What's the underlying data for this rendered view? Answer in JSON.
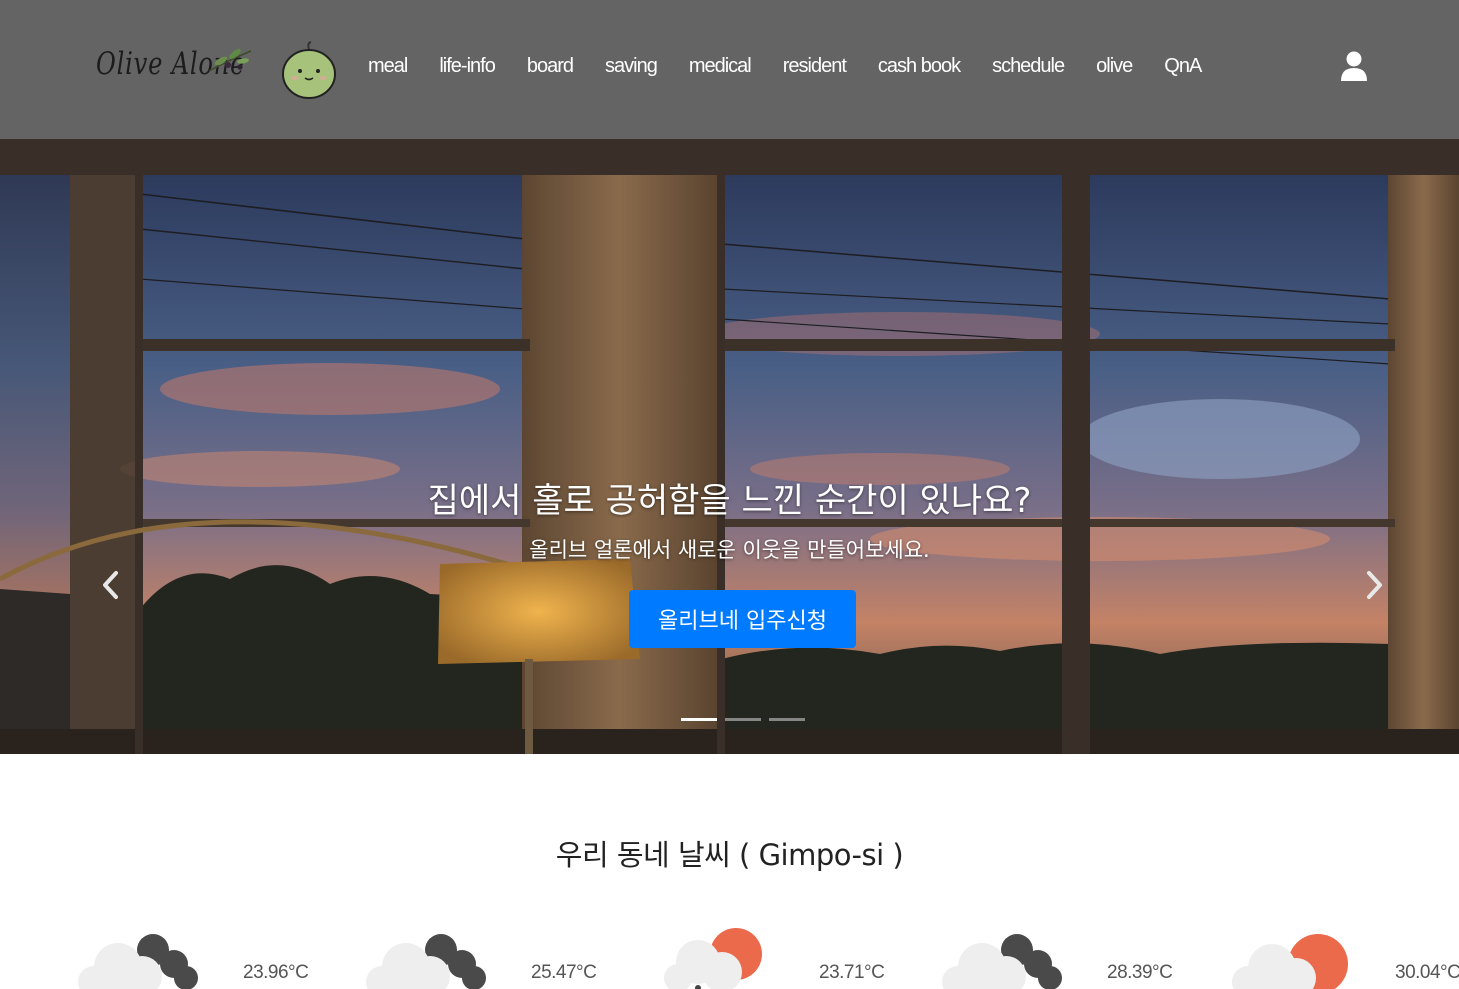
{
  "brand": {
    "logo_text": "Olive Alone"
  },
  "nav": {
    "items": [
      {
        "label": "meal"
      },
      {
        "label": "life-info"
      },
      {
        "label": "board"
      },
      {
        "label": "saving"
      },
      {
        "label": "medical"
      },
      {
        "label": "resident"
      },
      {
        "label": "cash book"
      },
      {
        "label": "schedule"
      },
      {
        "label": "olive"
      },
      {
        "label": "QnA"
      }
    ],
    "user_icon": "user-icon"
  },
  "hero": {
    "title": "집에서 홀로 공허함을 느낀 순간이 있나요?",
    "subtitle": "올리브 얼론에서 새로운 이웃을 만들어보세요.",
    "button_label": "올리브네 입주신청",
    "slide_count": 3,
    "active_slide": 1,
    "prev_icon": "chevron-left-icon",
    "next_icon": "chevron-right-icon"
  },
  "weather": {
    "title": "우리 동네 날씨 ( Gimpo-si )",
    "forecast": [
      {
        "icon": "dark-cloud-icon",
        "temp": "23.96°C"
      },
      {
        "icon": "dark-cloud-icon",
        "temp": "25.47°C"
      },
      {
        "icon": "sun-cloud-icon",
        "temp": "23.71°C"
      },
      {
        "icon": "dark-cloud-icon",
        "temp": "28.39°C"
      },
      {
        "icon": "sun-cloud-icon",
        "temp": "30.04°C"
      }
    ]
  },
  "colors": {
    "navbar_bg": "#646464",
    "primary_button": "#007bff",
    "sun": "#ec6a4c",
    "dark_cloud": "#4a4a4a",
    "light_cloud": "#eeeeee"
  }
}
